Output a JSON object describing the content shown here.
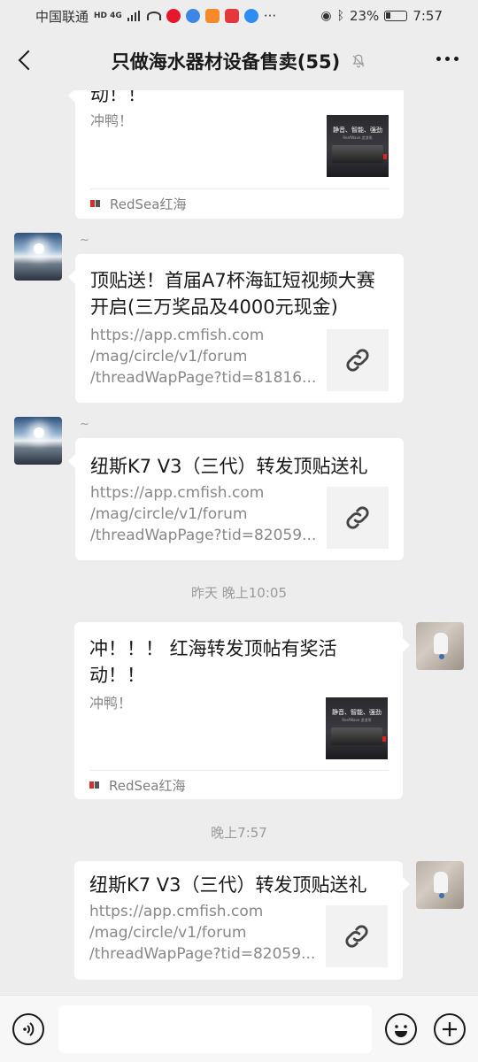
{
  "status_bar": {
    "carrier": "中国联通",
    "network_badges": "HD 4G",
    "dots": "···",
    "battery_percent": "23%",
    "time": "7:57"
  },
  "header": {
    "title": "只做海水器材设备售卖(55)",
    "back_icon": "chevron-left-icon",
    "mute_icon": "bell-off-icon",
    "more_icon": "more-dots-icon"
  },
  "messages": [
    {
      "sender": "other",
      "type": "article",
      "title_partial": "动！！",
      "desc": "冲鸭！",
      "thumb_headline": "静音、智能、强劲",
      "thumb_sub": "ReefWave 造浪泵",
      "source": "RedSea红海"
    },
    {
      "sender": "other",
      "name": "~",
      "type": "link",
      "title": "顶贴送！首届A7杯海缸短视频大赛开启(三万奖品及4000元现金)",
      "url_lines": [
        "https://app.cmfish.com",
        "/mag/circle/v1/forum",
        "/threadWapPage?tid=81816..."
      ]
    },
    {
      "sender": "other",
      "name": "~",
      "type": "link",
      "title": "纽斯K7 V3（三代）转发顶贴送礼",
      "url_lines": [
        "https://app.cmfish.com",
        "/mag/circle/v1/forum",
        "/threadWapPage?tid=82059..."
      ]
    },
    {
      "sender": "me",
      "type": "article",
      "title_lines": [
        "冲！！！ 红海转发顶帖有奖活",
        "动！！"
      ],
      "desc": "冲鸭！",
      "thumb_headline": "静音、智能、强劲",
      "thumb_sub": "ReefWave 造浪泵",
      "source": "RedSea红海"
    },
    {
      "sender": "me",
      "type": "link",
      "title": "纽斯K7 V3（三代）转发顶贴送礼",
      "url_lines": [
        "https://app.cmfish.com",
        "/mag/circle/v1/forum",
        "/threadWapPage?tid=82059..."
      ]
    }
  ],
  "timestamps": [
    "昨天 晚上10:05",
    "晚上7:57"
  ],
  "input_bar": {
    "voice_icon": "voice-icon",
    "emoji_icon": "emoji-icon",
    "plus_icon": "plus-icon"
  },
  "colors": {
    "background": "#ededed",
    "bubble": "#ffffff",
    "secondary_text": "#888888",
    "brand_red": "#d0302c"
  }
}
